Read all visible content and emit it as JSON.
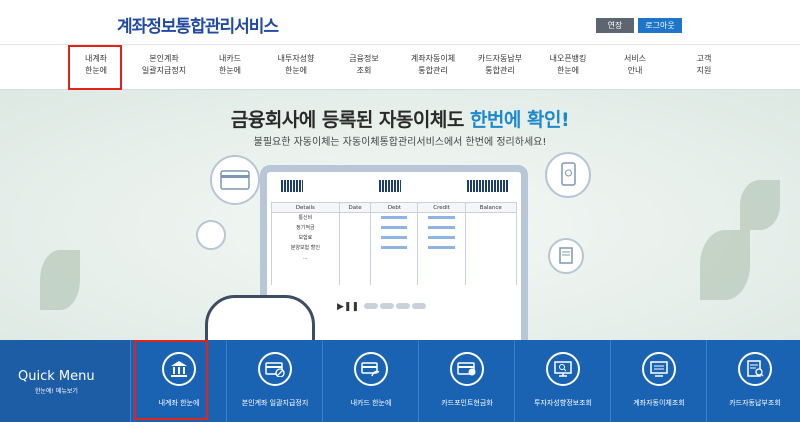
{
  "header": {
    "logo": "계좌정보통합관리서비스",
    "extend_label": "연장",
    "logout_label": "로그아웃"
  },
  "gnb": {
    "items": [
      {
        "label": "내계좌\n한눈에"
      },
      {
        "label": "본인계좌\n일괄지급정지"
      },
      {
        "label": "내카드\n한눈에"
      },
      {
        "label": "내투자성향\n한눈에"
      },
      {
        "label": "금융정보\n조회"
      },
      {
        "label": "계좌자동이체\n통합관리"
      },
      {
        "label": "카드자동납부\n통합관리"
      },
      {
        "label": "내오픈뱅킹\n한눈에"
      },
      {
        "label": "서비스\n안내"
      },
      {
        "label": "고객\n지원"
      }
    ]
  },
  "hero": {
    "title_prefix": "금융회사에 등록된 자동이체도 ",
    "title_highlight": "한번에 확인!",
    "subtitle": "불필요한 자동이체는 자동이체통합관리서비스에서 한번에 정리하세요!"
  },
  "tablet": {
    "columns": [
      "Details",
      "Date",
      "Debt",
      "Credit",
      "Balance"
    ],
    "rows": [
      "통신비",
      "정기적금",
      "보험료",
      "분양보험 할인",
      "..."
    ]
  },
  "quick_menu": {
    "title": "Quick Menu",
    "subtitle": "한눈에! 메뉴보기",
    "items": [
      {
        "label": "내계좌 한눈에",
        "icon": "bank-icon"
      },
      {
        "label": "본인계좌 일괄지급정지",
        "icon": "card-block-icon"
      },
      {
        "label": "내카드 한눈에",
        "icon": "card-hand-icon"
      },
      {
        "label": "카드포인트현금화",
        "icon": "card-point-icon"
      },
      {
        "label": "투자자성향정보조회",
        "icon": "monitor-search-icon"
      },
      {
        "label": "계좌자동이체조회",
        "icon": "monitor-list-icon"
      },
      {
        "label": "카드자동납부조회",
        "icon": "document-search-icon"
      }
    ]
  }
}
